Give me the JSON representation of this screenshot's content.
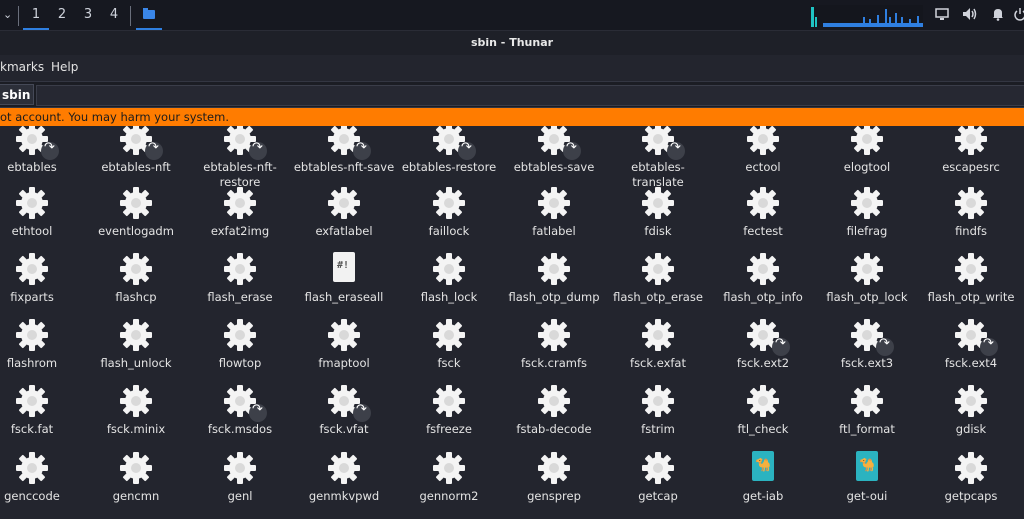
{
  "panel": {
    "dropdown": "⌄",
    "workspaces": [
      "1",
      "2",
      "3",
      "4"
    ],
    "tray_icons": [
      "display-icon",
      "volume-icon",
      "bell-icon",
      "power-icon"
    ]
  },
  "window": {
    "title": "sbin - Thunar",
    "menu": [
      "kmarks",
      "Help"
    ],
    "path_button": "sbin",
    "warning": "ot account. You may harm your system."
  },
  "colors": {
    "accent": "#2f7fe0",
    "warning": "#ff7c00",
    "bg": "#23252e"
  },
  "files": [
    {
      "name": "ebtables",
      "icon": "gear",
      "link": true
    },
    {
      "name": "ebtables-nft",
      "icon": "gear",
      "link": true
    },
    {
      "name": "ebtables-nft-restore",
      "icon": "gear",
      "link": true
    },
    {
      "name": "ebtables-nft-save",
      "icon": "gear",
      "link": true
    },
    {
      "name": "ebtables-restore",
      "icon": "gear",
      "link": true
    },
    {
      "name": "ebtables-save",
      "icon": "gear",
      "link": true
    },
    {
      "name": "ebtables-translate",
      "icon": "gear",
      "link": true
    },
    {
      "name": "ectool",
      "icon": "gear",
      "link": false
    },
    {
      "name": "elogtool",
      "icon": "gear",
      "link": false
    },
    {
      "name": "escapesrc",
      "icon": "gear",
      "link": false
    },
    {
      "name": "ethtool",
      "icon": "gear",
      "link": false
    },
    {
      "name": "eventlogadm",
      "icon": "gear",
      "link": false
    },
    {
      "name": "exfat2img",
      "icon": "gear",
      "link": false
    },
    {
      "name": "exfatlabel",
      "icon": "gear",
      "link": false
    },
    {
      "name": "faillock",
      "icon": "gear",
      "link": false
    },
    {
      "name": "fatlabel",
      "icon": "gear",
      "link": false
    },
    {
      "name": "fdisk",
      "icon": "gear",
      "link": false
    },
    {
      "name": "fectest",
      "icon": "gear",
      "link": false
    },
    {
      "name": "filefrag",
      "icon": "gear",
      "link": false
    },
    {
      "name": "findfs",
      "icon": "gear",
      "link": false
    },
    {
      "name": "fixparts",
      "icon": "gear",
      "link": false
    },
    {
      "name": "flashcp",
      "icon": "gear",
      "link": false
    },
    {
      "name": "flash_erase",
      "icon": "gear",
      "link": false
    },
    {
      "name": "flash_eraseall",
      "icon": "script",
      "link": false
    },
    {
      "name": "flash_lock",
      "icon": "gear",
      "link": false
    },
    {
      "name": "flash_otp_dump",
      "icon": "gear",
      "link": false
    },
    {
      "name": "flash_otp_erase",
      "icon": "gear",
      "link": false
    },
    {
      "name": "flash_otp_info",
      "icon": "gear",
      "link": false
    },
    {
      "name": "flash_otp_lock",
      "icon": "gear",
      "link": false
    },
    {
      "name": "flash_otp_write",
      "icon": "gear",
      "link": false
    },
    {
      "name": "flashrom",
      "icon": "gear",
      "link": false
    },
    {
      "name": "flash_unlock",
      "icon": "gear",
      "link": false
    },
    {
      "name": "flowtop",
      "icon": "gear",
      "link": false
    },
    {
      "name": "fmaptool",
      "icon": "gear",
      "link": false
    },
    {
      "name": "fsck",
      "icon": "gear",
      "link": false
    },
    {
      "name": "fsck.cramfs",
      "icon": "gear",
      "link": false
    },
    {
      "name": "fsck.exfat",
      "icon": "gear",
      "link": false
    },
    {
      "name": "fsck.ext2",
      "icon": "gear",
      "link": true
    },
    {
      "name": "fsck.ext3",
      "icon": "gear",
      "link": true
    },
    {
      "name": "fsck.ext4",
      "icon": "gear",
      "link": true
    },
    {
      "name": "fsck.fat",
      "icon": "gear",
      "link": false
    },
    {
      "name": "fsck.minix",
      "icon": "gear",
      "link": false
    },
    {
      "name": "fsck.msdos",
      "icon": "gear",
      "link": true
    },
    {
      "name": "fsck.vfat",
      "icon": "gear",
      "link": true
    },
    {
      "name": "fsfreeze",
      "icon": "gear",
      "link": false
    },
    {
      "name": "fstab-decode",
      "icon": "gear",
      "link": false
    },
    {
      "name": "fstrim",
      "icon": "gear",
      "link": false
    },
    {
      "name": "ftl_check",
      "icon": "gear",
      "link": false
    },
    {
      "name": "ftl_format",
      "icon": "gear",
      "link": false
    },
    {
      "name": "gdisk",
      "icon": "gear",
      "link": false
    },
    {
      "name": "genccode",
      "icon": "gear",
      "link": false
    },
    {
      "name": "gencmn",
      "icon": "gear",
      "link": false
    },
    {
      "name": "genl",
      "icon": "gear",
      "link": false
    },
    {
      "name": "genmkvpwd",
      "icon": "gear",
      "link": false
    },
    {
      "name": "gennorm2",
      "icon": "gear",
      "link": false
    },
    {
      "name": "gensprep",
      "icon": "gear",
      "link": false
    },
    {
      "name": "getcap",
      "icon": "gear",
      "link": false
    },
    {
      "name": "get-iab",
      "icon": "camel",
      "link": false
    },
    {
      "name": "get-oui",
      "icon": "camel",
      "link": false
    },
    {
      "name": "getpcaps",
      "icon": "gear",
      "link": false
    }
  ]
}
